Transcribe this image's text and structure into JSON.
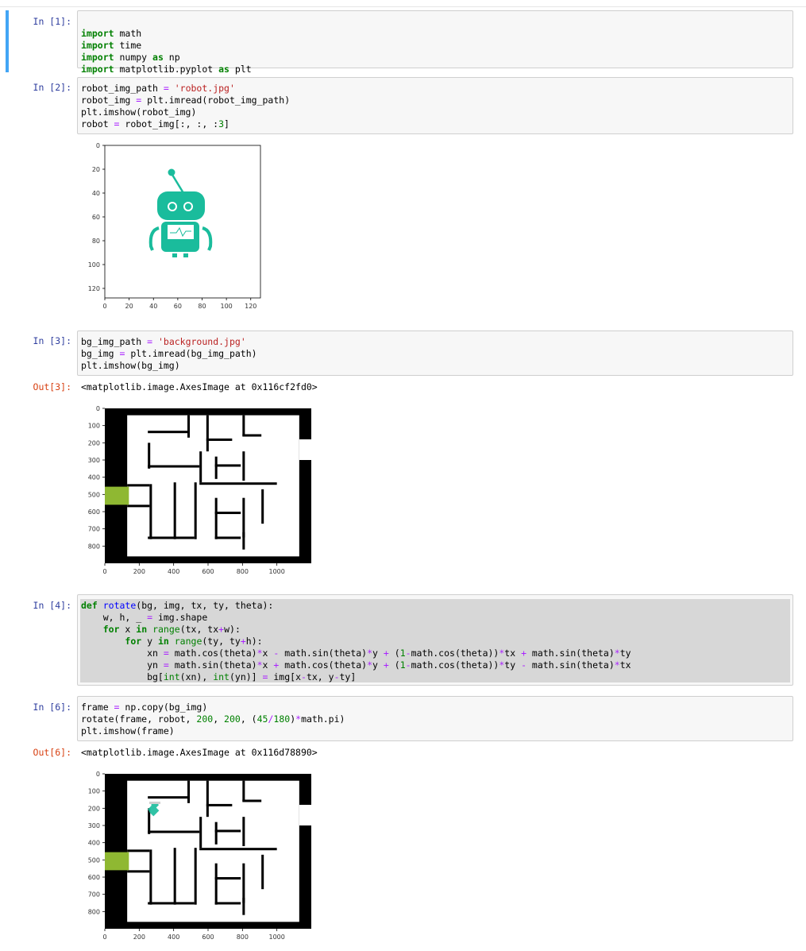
{
  "notebook": {
    "cells": [
      {
        "prompt": "In [1]:",
        "code": [
          "import math",
          "import time",
          "import numpy as np",
          "import matplotlib.pyplot as plt"
        ]
      },
      {
        "prompt": "In [2]:",
        "code": [
          "robot_img_path = 'robot.jpg'",
          "robot_img = plt.imread(robot_img_path)",
          "plt.imshow(robot_img)",
          "robot = robot_img[:, :, :3]"
        ]
      },
      {
        "prompt": "In [3]:",
        "code": [
          "bg_img_path = 'background.jpg'",
          "bg_img = plt.imread(bg_img_path)",
          "plt.imshow(bg_img)"
        ],
        "out_prompt": "Out[3]:",
        "out_text": "<matplotlib.image.AxesImage at 0x116cf2fd0>"
      },
      {
        "prompt": "In [4]:",
        "code": [
          "def rotate(bg, img, tx, ty, theta):",
          "    w, h, _ = img.shape",
          "    for x in range(tx, tx+w):",
          "        for y in range(ty, ty+h):",
          "            xn = math.cos(theta)*x - math.sin(theta)*y + (1-math.cos(theta))*tx + math.sin(theta)*ty",
          "            yn = math.sin(theta)*x + math.cos(theta)*y + (1-math.cos(theta))*ty - math.sin(theta)*tx",
          "            bg[int(xn), int(yn)] = img[x-tx, y-ty]"
        ]
      },
      {
        "prompt": "In [6]:",
        "code": [
          "frame = np.copy(bg_img)",
          "rotate(frame, robot, 200, 200, (45/180)*math.pi)",
          "plt.imshow(frame)"
        ],
        "out_prompt": "Out[6]:",
        "out_text": "<matplotlib.image.AxesImage at 0x116d78890>"
      }
    ]
  },
  "plots": {
    "robot_plot": {
      "xticks": [
        "0",
        "20",
        "40",
        "60",
        "80",
        "100",
        "120"
      ],
      "yticks": [
        "0",
        "20",
        "40",
        "60",
        "80",
        "100",
        "120"
      ],
      "robot_color": "#1abc9c"
    },
    "maze_plot": {
      "xticks": [
        "0",
        "200",
        "400",
        "600",
        "800",
        "1000"
      ],
      "yticks": [
        "0",
        "100",
        "200",
        "300",
        "400",
        "500",
        "600",
        "700",
        "800"
      ],
      "wall_color": "#000000",
      "floor_color": "#ffffff",
      "start_color": "#8fb832"
    }
  }
}
